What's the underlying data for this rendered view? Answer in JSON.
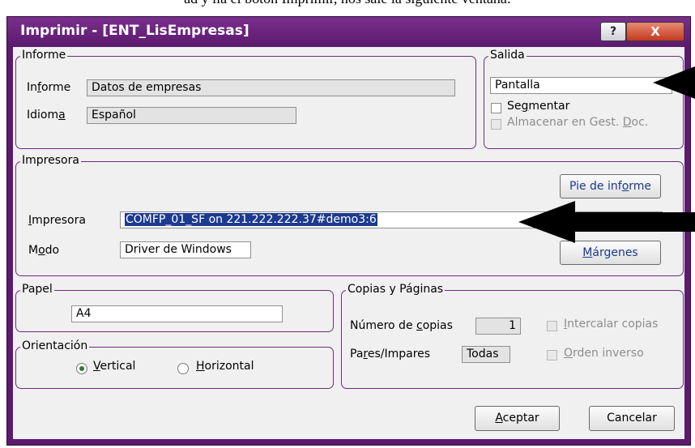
{
  "doc_text": "ad y lla el botón Imprimir, nos sale la siguiente ventana:",
  "window": {
    "title": "Imprimir - [ENT_LisEmpresas]",
    "help_label": "?",
    "close_label": "X"
  },
  "informe": {
    "group_label": "Informe",
    "informe_label_pre": "In",
    "informe_label_key": "f",
    "informe_label_post": "orme",
    "informe_value": "Datos de empresas",
    "idioma_label_pre": "Idiom",
    "idioma_label_key": "a",
    "idioma_label_post": "",
    "idioma_value": "Español"
  },
  "salida": {
    "group_label": "Salida",
    "value": "Pantalla",
    "segmentar_pre": "Se",
    "segmentar_key": "g",
    "segmentar_post": "mentar",
    "almacenar_pre": "Almacenar en Gest. ",
    "almacenar_key": "D",
    "almacenar_post": "oc."
  },
  "impresora": {
    "group_label": "Impresora",
    "impresora_label_pre": "",
    "impresora_label_key": "I",
    "impresora_label_post": "mpresora",
    "impresora_value": "COMFP_01_SF on 221.222.222.37#demo3:6",
    "modo_label_pre": "M",
    "modo_label_key": "o",
    "modo_label_post": "do",
    "modo_value": "Driver de Windows",
    "pie_pre": "Pie de inf",
    "pie_key": "o",
    "pie_post": "rme",
    "margenes_pre": "",
    "margenes_key": "M",
    "margenes_post": "árgenes"
  },
  "papel": {
    "group_label": "Papel",
    "value": "A4"
  },
  "orientacion": {
    "group_label": "Orientación",
    "vertical_pre": "",
    "vertical_key": "V",
    "vertical_post": "ertical",
    "horizontal_pre": "",
    "horizontal_key": "H",
    "horizontal_post": "orizontal"
  },
  "copias": {
    "group_label": "Copias y Páginas",
    "numero_pre": "Número de ",
    "numero_key": "c",
    "numero_post": "opias",
    "numero_value": "1",
    "pares_pre": "Pa",
    "pares_key": "r",
    "pares_post": "es/Impares",
    "pares_value": "Todas",
    "intercalar_pre": "",
    "intercalar_key": "I",
    "intercalar_post": "ntercalar copias",
    "orden_pre": "",
    "orden_key": "O",
    "orden_post": "rden inverso"
  },
  "footer": {
    "aceptar_pre": "",
    "aceptar_key": "A",
    "aceptar_post": "ceptar",
    "cancelar_label": "Cancelar"
  },
  "colors": {
    "title_bar": "#5b1a6e",
    "group_border": "#6d2c7e",
    "selection": "#1c3a8f",
    "close": "#c23a20"
  }
}
